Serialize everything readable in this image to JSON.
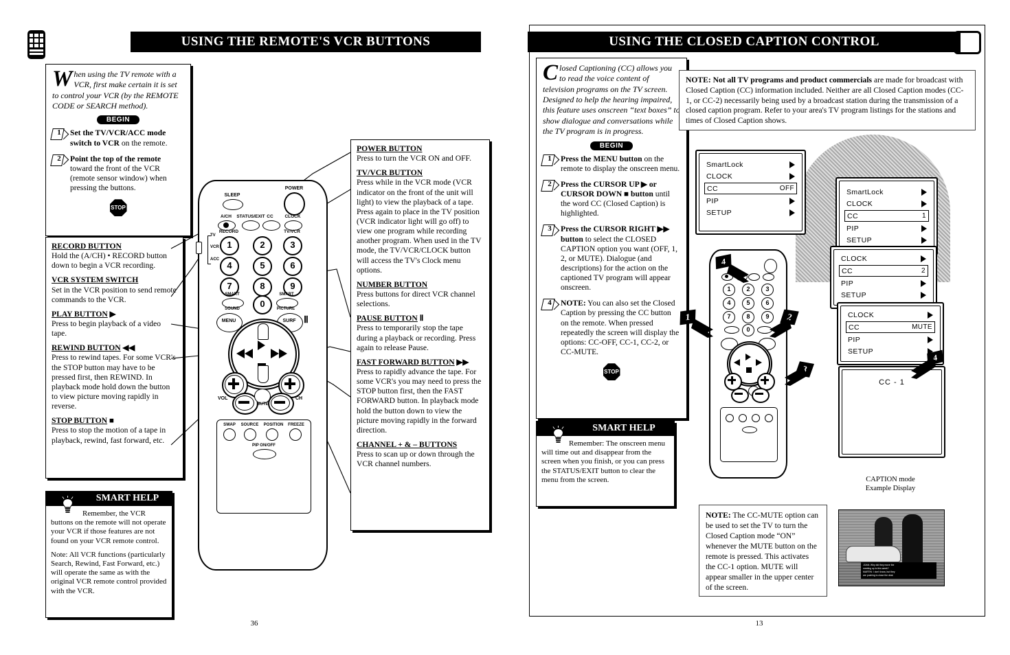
{
  "left_page": {
    "number": "36",
    "corner_icon": "remote-control-icon",
    "banner_title": "USING THE REMOTE'S VCR BUTTONS",
    "intro": {
      "dropcap": "W",
      "text": "hen using the TV remote with a VCR, first make certain it is set to control your VCR (by the REMOTE CODE or SEARCH method).",
      "begin_label": "BEGIN",
      "stop_label": "STOP",
      "steps": [
        {
          "num": "1",
          "bold": "Set the TV/VCR/ACC mode switch to VCR",
          "rest": " on the remote."
        },
        {
          "num": "2",
          "bold": "Point the top of the remote",
          "rest": " toward the front of the VCR (remote sensor window) when pressing the buttons."
        }
      ]
    },
    "left_callouts": [
      {
        "title": "RECORD BUTTON",
        "symbol": "",
        "body": "Hold the (A/CH) • RECORD button down to begin a VCR recording."
      },
      {
        "title": "VCR SYSTEM SWITCH",
        "symbol": "",
        "body": "Set in the VCR position to send remote commands to the VCR."
      },
      {
        "title": "PLAY BUTTON",
        "symbol": "▶",
        "body": "Press to begin playback of a video tape."
      },
      {
        "title": "REWIND BUTTON",
        "symbol": "◀◀",
        "body": "Press to rewind tapes. For some VCR's the STOP button may have to be pressed first, then REWIND. In playback mode hold down the button to view picture moving rapidly in reverse."
      },
      {
        "title": "STOP BUTTON",
        "symbol": "■",
        "body": "Press to stop the motion of a tape in playback, rewind, fast forward, etc."
      }
    ],
    "right_callouts": [
      {
        "title": "POWER BUTTON",
        "symbol": "",
        "body": "Press to turn the VCR ON and OFF."
      },
      {
        "title": "TV/VCR BUTTON",
        "symbol": "",
        "body": "Press while in the VCR mode (VCR indicator on the front of the unit will light) to view the playback of a tape. Press again to place in the TV position (VCR indicator light will go off) to view one program while recording another program. When used in the TV mode, the TV/VCR/CLOCK button will access the TV's Clock menu options."
      },
      {
        "title": "NUMBER BUTTON",
        "symbol": "",
        "body": "Press buttons for direct VCR channel selections."
      },
      {
        "title": "PAUSE BUTTON",
        "symbol": "Ⅱ",
        "body": "Press to temporarily stop the tape during a playback or recording. Press again to release Pause."
      },
      {
        "title": "FAST FORWARD BUTTON",
        "symbol": "▶▶",
        "body": "Press to rapidly advance the tape. For some VCR's you may need to press the STOP button first, then the FAST FORWARD button. In playback mode hold the button down to view the picture moving rapidly in the forward direction."
      },
      {
        "title": "CHANNEL + & – BUTTONS",
        "symbol": "",
        "body": "Press to scan up or down through the VCR channel numbers."
      }
    ],
    "smart_help": {
      "title": "SMART HELP",
      "paragraphs": [
        "Remember, the VCR buttons on the remote will not operate your VCR if those features are not found on your VCR remote control.",
        "Note: All VCR functions (particularly Search, Rewind, Fast Forward, etc.) will operate the same as with the original VCR remote control provided with the VCR."
      ]
    },
    "remote": {
      "top_labels": [
        "SLEEP",
        "POWER",
        "A/CH",
        "STATUS/EXIT",
        "CC",
        "CLOCK",
        "RECORD",
        "TV/VCR"
      ],
      "switch_labels": [
        "TV",
        "VCR",
        "ACC"
      ],
      "numbers": [
        "1",
        "2",
        "3",
        "4",
        "5",
        "6",
        "7",
        "8",
        "9",
        "0"
      ],
      "smart_labels": [
        "SMART",
        "SOUND",
        "SMART",
        "PICTURE"
      ],
      "menu_label": "MENU",
      "surf_label": "SURF",
      "pause_glyph": "Ⅱ",
      "vol_label": "VOL",
      "ch_label": "CH",
      "mute_label": "MUTE",
      "pip_labels": [
        "SWAP",
        "SOURCE",
        "POSITION",
        "FREEZE"
      ],
      "pip_onoff": "PIP ON/OFF"
    }
  },
  "right_page": {
    "number": "13",
    "corner_icon": "tv-screen-icon",
    "banner_title": "USING THE CLOSED CAPTION CONTROL",
    "intro": {
      "dropcap": "C",
      "text": "losed Captioning (CC) allows you to read the voice content of television programs on the TV screen. Designed to help the hearing impaired, this feature uses onscreen “text boxes” to show dialogue and conversations while the TV program is in progress.",
      "begin_label": "BEGIN",
      "stop_label": "STOP",
      "steps": [
        {
          "num": "1",
          "bold": "Press the MENU button",
          "rest": " on the remote to display the onscreen menu."
        },
        {
          "num": "2",
          "bold": "Press the CURSOR UP ▶ or CURSOR DOWN ■ button",
          "rest": " until the word CC (Closed Caption) is highlighted."
        },
        {
          "num": "3",
          "bold": "Press the CURSOR RIGHT ▶▶ button",
          "rest": " to select the CLOSED CAPTION option you want (OFF, 1, 2, or MUTE). Dialogue (and descriptions) for the action on the captioned TV program will appear onscreen."
        },
        {
          "num": "4",
          "bold": "NOTE:",
          "rest": " You can also set the Closed Caption by pressing the CC button on the remote. When pressed repeatedly the screen will display the options: CC-OFF, CC-1, CC-2, or CC-MUTE."
        }
      ]
    },
    "top_note": {
      "lead": "NOTE: Not all TV programs and product commercials",
      "rest": " are made for broadcast with Closed Caption (CC) information included. Neither are all Closed Caption modes (CC-1, or CC-2) necessarily being used by a broadcast station during the transmission of a closed caption program. Refer to your area's TV program listings for the stations and times of Closed Caption shows."
    },
    "smart_help": {
      "title": "SMART HELP",
      "paragraphs": [
        "Remember: The onscreen menu will time out and disappear from the screen when you finish, or you can press the STATUS/EXIT button to clear the menu from the screen."
      ]
    },
    "bottom_note": {
      "lead": "NOTE:",
      "rest": " The CC-MUTE option can be used to set the TV to turn the Closed Caption mode “ON” whenever the MUTE button on the remote is pressed. This activates the CC-1 option. MUTE will appear smaller in the upper center of the screen."
    },
    "menus": [
      {
        "name": "menu-cc-off",
        "rows": [
          {
            "label": "SmartLock",
            "value": "▶"
          },
          {
            "label": "CLOCK",
            "value": "▶"
          },
          {
            "label": "CC",
            "value": "OFF",
            "selected": true
          },
          {
            "label": "PIP",
            "value": "▶"
          },
          {
            "label": "SETUP",
            "value": "▶"
          }
        ]
      },
      {
        "name": "menu-cc-1",
        "rows": [
          {
            "label": "SmartLock",
            "value": "▶"
          },
          {
            "label": "CLOCK",
            "value": "▶"
          },
          {
            "label": "CC",
            "value": "1",
            "selected": true
          },
          {
            "label": "PIP",
            "value": "▶"
          },
          {
            "label": "SETUP",
            "value": "▶"
          }
        ]
      },
      {
        "name": "menu-cc-2",
        "rows": [
          {
            "label": "CLOCK",
            "value": "▶"
          },
          {
            "label": "CC",
            "value": "2",
            "selected": true
          },
          {
            "label": "PIP",
            "value": "▶"
          },
          {
            "label": "SETUP",
            "value": "▶"
          }
        ]
      },
      {
        "name": "menu-cc-mute",
        "rows": [
          {
            "label": "CLOCK",
            "value": "▶"
          },
          {
            "label": "CC",
            "value": "MUTE",
            "selected": true
          },
          {
            "label": "PIP",
            "value": "▶"
          },
          {
            "label": "SETUP",
            "value": "▶"
          }
        ]
      }
    ],
    "caption_screen": {
      "display_text": "CC - 1",
      "caption_line1": "CAPTION mode",
      "caption_line2": "Example Display"
    },
    "photo_caption": {
      "line1": "JOAN: Why did they move the",
      "line2": "meeting up to this week?",
      "line3": "MARTIN: I don't know, but they",
      "line4": "are pushing to close the deal."
    },
    "remote_callouts": [
      "1",
      "2",
      "3",
      "4"
    ]
  }
}
